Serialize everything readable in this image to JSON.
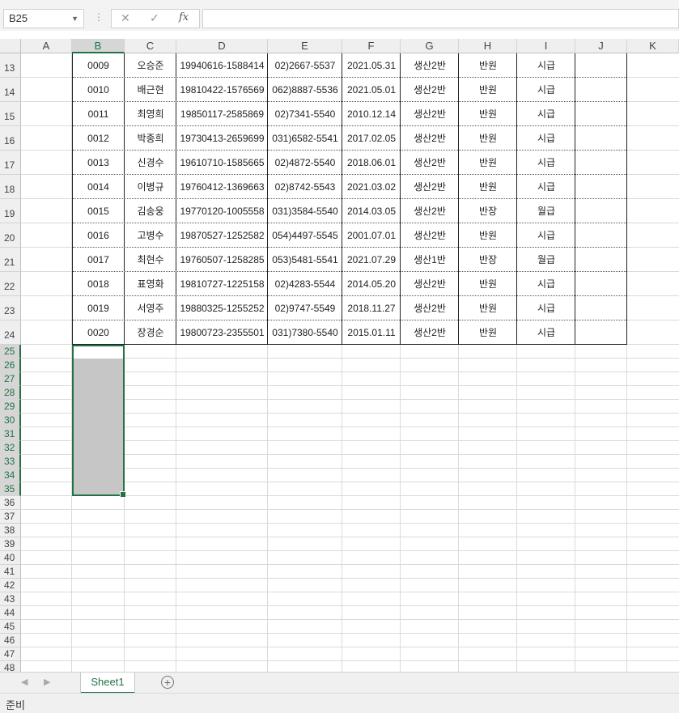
{
  "formula_bar": {
    "name_box": "B25",
    "cancel_icon": "✕",
    "enter_icon": "✓",
    "fx_label": "fx",
    "formula": ""
  },
  "columns": [
    "A",
    "B",
    "C",
    "D",
    "E",
    "F",
    "G",
    "H",
    "I",
    "J",
    "K"
  ],
  "selected_column": "B",
  "data_rows": [
    {
      "row": "13",
      "cells": [
        "0009",
        "오승준",
        "19940616-1588414",
        "02)2667-5537",
        "2021.05.31",
        "생산2반",
        "반원",
        "시급"
      ]
    },
    {
      "row": "14",
      "cells": [
        "0010",
        "배근현",
        "19810422-1576569",
        "062)8887-5536",
        "2021.05.01",
        "생산2반",
        "반원",
        "시급"
      ]
    },
    {
      "row": "15",
      "cells": [
        "0011",
        "최영희",
        "19850117-2585869",
        "02)7341-5540",
        "2010.12.14",
        "생산2반",
        "반원",
        "시급"
      ]
    },
    {
      "row": "16",
      "cells": [
        "0012",
        "박종희",
        "19730413-2659699",
        "031)6582-5541",
        "2017.02.05",
        "생산2반",
        "반원",
        "시급"
      ]
    },
    {
      "row": "17",
      "cells": [
        "0013",
        "신경수",
        "19610710-1585665",
        "02)4872-5540",
        "2018.06.01",
        "생산2반",
        "반원",
        "시급"
      ]
    },
    {
      "row": "18",
      "cells": [
        "0014",
        "이병규",
        "19760412-1369663",
        "02)8742-5543",
        "2021.03.02",
        "생산2반",
        "반원",
        "시급"
      ]
    },
    {
      "row": "19",
      "cells": [
        "0015",
        "김송웅",
        "19770120-1005558",
        "031)3584-5540",
        "2014.03.05",
        "생산2반",
        "반장",
        "월급"
      ]
    },
    {
      "row": "20",
      "cells": [
        "0016",
        "고병수",
        "19870527-1252582",
        "054)4497-5545",
        "2001.07.01",
        "생산2반",
        "반원",
        "시급"
      ]
    },
    {
      "row": "21",
      "cells": [
        "0017",
        "최현수",
        "19760507-1258285",
        "053)5481-5541",
        "2021.07.29",
        "생산1반",
        "반장",
        "월급"
      ]
    },
    {
      "row": "22",
      "cells": [
        "0018",
        "표영화",
        "19810727-1225158",
        "02)4283-5544",
        "2014.05.20",
        "생산2반",
        "반원",
        "시급"
      ]
    },
    {
      "row": "23",
      "cells": [
        "0019",
        "서영주",
        "19880325-1255252",
        "02)9747-5549",
        "2018.11.27",
        "생산2반",
        "반원",
        "시급"
      ]
    },
    {
      "row": "24",
      "cells": [
        "0020",
        "장경순",
        "19800723-2355501",
        "031)7380-5540",
        "2015.01.11",
        "생산2반",
        "반원",
        "시급"
      ]
    }
  ],
  "empty_rows": [
    "25",
    "26",
    "27",
    "28",
    "29",
    "30",
    "31",
    "32",
    "33",
    "34",
    "35",
    "36",
    "37",
    "38",
    "39",
    "40",
    "41",
    "42",
    "43",
    "44",
    "45",
    "46",
    "47",
    "48"
  ],
  "selected_rows": [
    "25",
    "26",
    "27",
    "28",
    "29",
    "30",
    "31",
    "32",
    "33",
    "34",
    "35"
  ],
  "sheet_tabs": [
    "Sheet1"
  ],
  "add_sheet_icon": "+",
  "status": "준비",
  "accent_color": "#217346"
}
